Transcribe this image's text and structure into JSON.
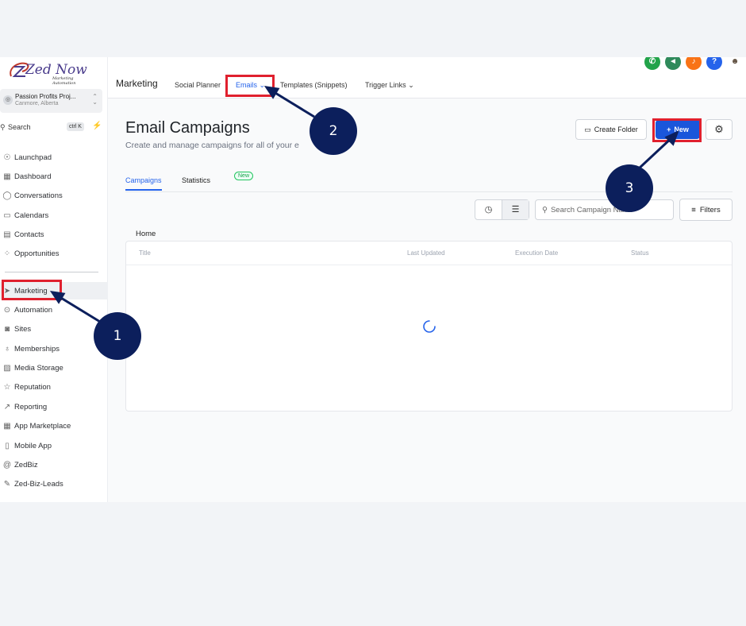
{
  "app": {
    "logo_text": "Zed Now",
    "logo_subtext": "Marketing Automation"
  },
  "account": {
    "name": "Passion Profits Proj...",
    "location": "Canmore, Alberta"
  },
  "search": {
    "label": "Search",
    "shortcut": "ctrl K"
  },
  "sidebar": {
    "items": [
      {
        "label": "Launchpad",
        "icon": "rocket-icon"
      },
      {
        "label": "Dashboard",
        "icon": "grid-icon"
      },
      {
        "label": "Conversations",
        "icon": "chat-icon"
      },
      {
        "label": "Calendars",
        "icon": "calendar-icon"
      },
      {
        "label": "Contacts",
        "icon": "contacts-icon"
      },
      {
        "label": "Opportunities",
        "icon": "opportunities-icon"
      },
      {
        "label": "Marketing",
        "icon": "send-icon",
        "active": true
      },
      {
        "label": "Automation",
        "icon": "automation-icon"
      },
      {
        "label": "Sites",
        "icon": "sites-icon"
      },
      {
        "label": "Memberships",
        "icon": "badge-icon"
      },
      {
        "label": "Media Storage",
        "icon": "image-icon"
      },
      {
        "label": "Reputation",
        "icon": "star-icon"
      },
      {
        "label": "Reporting",
        "icon": "trend-icon"
      },
      {
        "label": "App Marketplace",
        "icon": "grid-icon"
      },
      {
        "label": "Mobile App",
        "icon": "mobile-icon"
      },
      {
        "label": "ZedBiz",
        "icon": "at-icon"
      },
      {
        "label": "Zed-Biz-Leads",
        "icon": "wrench-icon"
      }
    ]
  },
  "topnav": {
    "title": "Marketing",
    "tabs": [
      {
        "label": "Social Planner"
      },
      {
        "label": "Emails",
        "active": true
      },
      {
        "label": "Templates (Snippets)"
      },
      {
        "label": "Trigger Links"
      }
    ]
  },
  "page": {
    "title": "Email Campaigns",
    "subtitle": "Create and manage campaigns for all of your e",
    "create_folder_label": "Create Folder",
    "new_label": "New",
    "subtabs": [
      {
        "label": "Campaigns",
        "active": true
      },
      {
        "label": "Statistics"
      }
    ],
    "statistics_badge": "New",
    "search_placeholder": "Search Campaign Name",
    "filters_label": "Filters",
    "breadcrumb": "Home",
    "columns": [
      "Title",
      "Last Updated",
      "Execution Date",
      "Status"
    ]
  },
  "annotations": {
    "step1": "1",
    "step2": "2",
    "step3": "3"
  },
  "colors": {
    "accent": "#2563eb",
    "new_button": "#1a56db",
    "highlight": "#e0202e",
    "marker": "#0c1f5c"
  }
}
